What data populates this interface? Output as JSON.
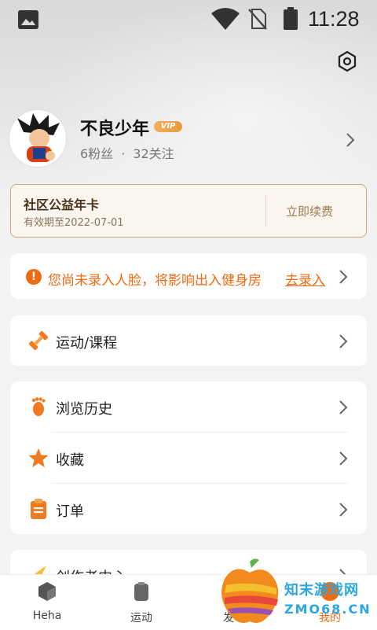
{
  "status_bar": {
    "time": "11:28"
  },
  "profile": {
    "username": "不良少年",
    "vip_badge": "VIP",
    "fans": "6粉丝",
    "separator": "·",
    "following": "32关注"
  },
  "membership": {
    "title": "社区公益年卡",
    "expire": "有效期至2022-07-01",
    "renew": "立即续费"
  },
  "alert": {
    "icon_text": "!",
    "message": "您尚未录入人脸，将影响出入健身房",
    "action": "去录入"
  },
  "menu": {
    "sport": "运动/课程",
    "history": "浏览历史",
    "favorites": "收藏",
    "orders": "订单",
    "creator": "创作者中心"
  },
  "nav": {
    "home": "Heha",
    "sport": "运动",
    "post": "发",
    "mine": "我的"
  },
  "watermark": {
    "line1": "知末游戏网",
    "line2": "ZMO68.CN"
  },
  "colors": {
    "accent": "#f06a12",
    "gold": "#c9a97e"
  }
}
